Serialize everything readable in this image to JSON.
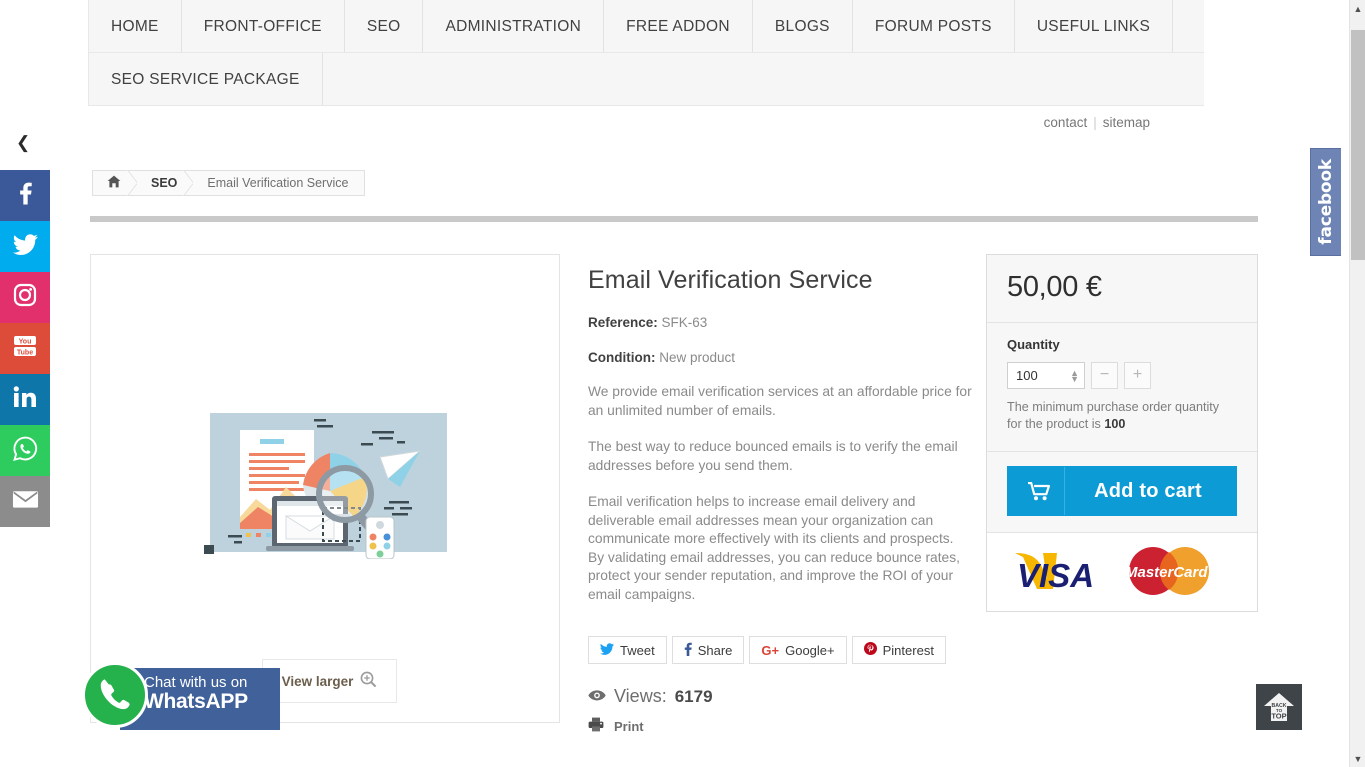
{
  "nav": {
    "row1": [
      {
        "label": "HOME"
      },
      {
        "label": "FRONT-OFFICE"
      },
      {
        "label": "SEO"
      },
      {
        "label": "ADMINISTRATION"
      },
      {
        "label": "FREE ADDON"
      },
      {
        "label": "BLOGS"
      },
      {
        "label": "FORUM POSTS"
      },
      {
        "label": "USEFUL LINKS"
      }
    ],
    "row2": [
      {
        "label": "SEO SERVICE PACKAGE"
      }
    ]
  },
  "utility": {
    "contact": "contact",
    "separator": "|",
    "sitemap": "sitemap"
  },
  "breadcrumb": {
    "home_icon": "home-icon",
    "items": [
      {
        "label": "SEO"
      },
      {
        "label": "Email Verification Service"
      }
    ]
  },
  "product": {
    "title": "Email Verification Service",
    "reference_label": "Reference:",
    "reference_value": "SFK-63",
    "condition_label": "Condition:",
    "condition_value": "New product",
    "paragraphs": [
      "We provide email verification services at an affordable price for an unlimited number of emails.",
      "The best way to reduce bounced emails is to verify the email addresses before you send them.",
      "Email verification helps to increase email delivery and deliverable email addresses mean your organization can communicate more effectively with its clients and prospects. By validating email addresses, you can reduce bounce rates, protect your sender reputation, and improve the ROI of your email campaigns."
    ],
    "view_larger": "View larger",
    "view_larger_icon": "magnifier-plus-icon"
  },
  "share": {
    "buttons": [
      {
        "label": "Tweet",
        "icon": "twitter-icon",
        "glyph": "ᵛ",
        "color": "#1da1f2"
      },
      {
        "label": "Share",
        "icon": "facebook-icon",
        "glyph": "f",
        "color": "#3b5998"
      },
      {
        "label": "Google+",
        "icon": "google-plus-icon",
        "glyph": "G+",
        "color": "#db4437"
      },
      {
        "label": "Pinterest",
        "icon": "pinterest-icon",
        "glyph": "P",
        "color": "#bd081c"
      }
    ]
  },
  "stats": {
    "views_icon": "eye-icon",
    "views_label": "Views:",
    "views_count": "6179",
    "print_icon": "printer-icon",
    "print_label": "Print"
  },
  "buy_box": {
    "price": "50,00 €",
    "quantity_label": "Quantity",
    "quantity_value": "100",
    "minus_label": "−",
    "plus_label": "+",
    "min_note_prefix": "The minimum purchase order quantity for the product is ",
    "min_note_value": "100",
    "add_to_cart_label": "Add to cart",
    "cart_icon": "shopping-cart-icon",
    "payment_icons": [
      "visa-logo",
      "mastercard-logo"
    ],
    "visa_text": "VISA",
    "mastercard_text": "MasterCard",
    "accent_color": "#0d9bd6"
  },
  "social_rail": {
    "collapse_icon": "chevron-left-icon",
    "items": [
      {
        "name": "facebook",
        "glyph": "f",
        "color": "#3b5998"
      },
      {
        "name": "twitter",
        "glyph": "ᵛ",
        "color": "#00aced"
      },
      {
        "name": "instagram",
        "glyph": "▣",
        "color": "#e1306c"
      },
      {
        "name": "youtube",
        "glyph": "▶",
        "color": "#dd4b39"
      },
      {
        "name": "linkedin",
        "glyph": "in",
        "color": "#0e76a8"
      },
      {
        "name": "whatsapp",
        "glyph": "✆",
        "color": "#2ecc5e"
      },
      {
        "name": "email",
        "glyph": "✉",
        "color": "#8c8c8c"
      }
    ]
  },
  "facebook_tab": {
    "label": "facebook",
    "color": "#6d84b4"
  },
  "whatsapp_widget": {
    "line1": "Chat with us on",
    "line2": "WhatsAPP",
    "icon": "whatsapp-phone-icon"
  },
  "back_to_top": {
    "line1": "BACK",
    "line2": "TO",
    "line3": "TOP",
    "icon": "up-arrow-home-icon"
  },
  "scrollbar": {
    "up_icon": "chevron-up-icon",
    "down_icon": "chevron-down-icon"
  }
}
